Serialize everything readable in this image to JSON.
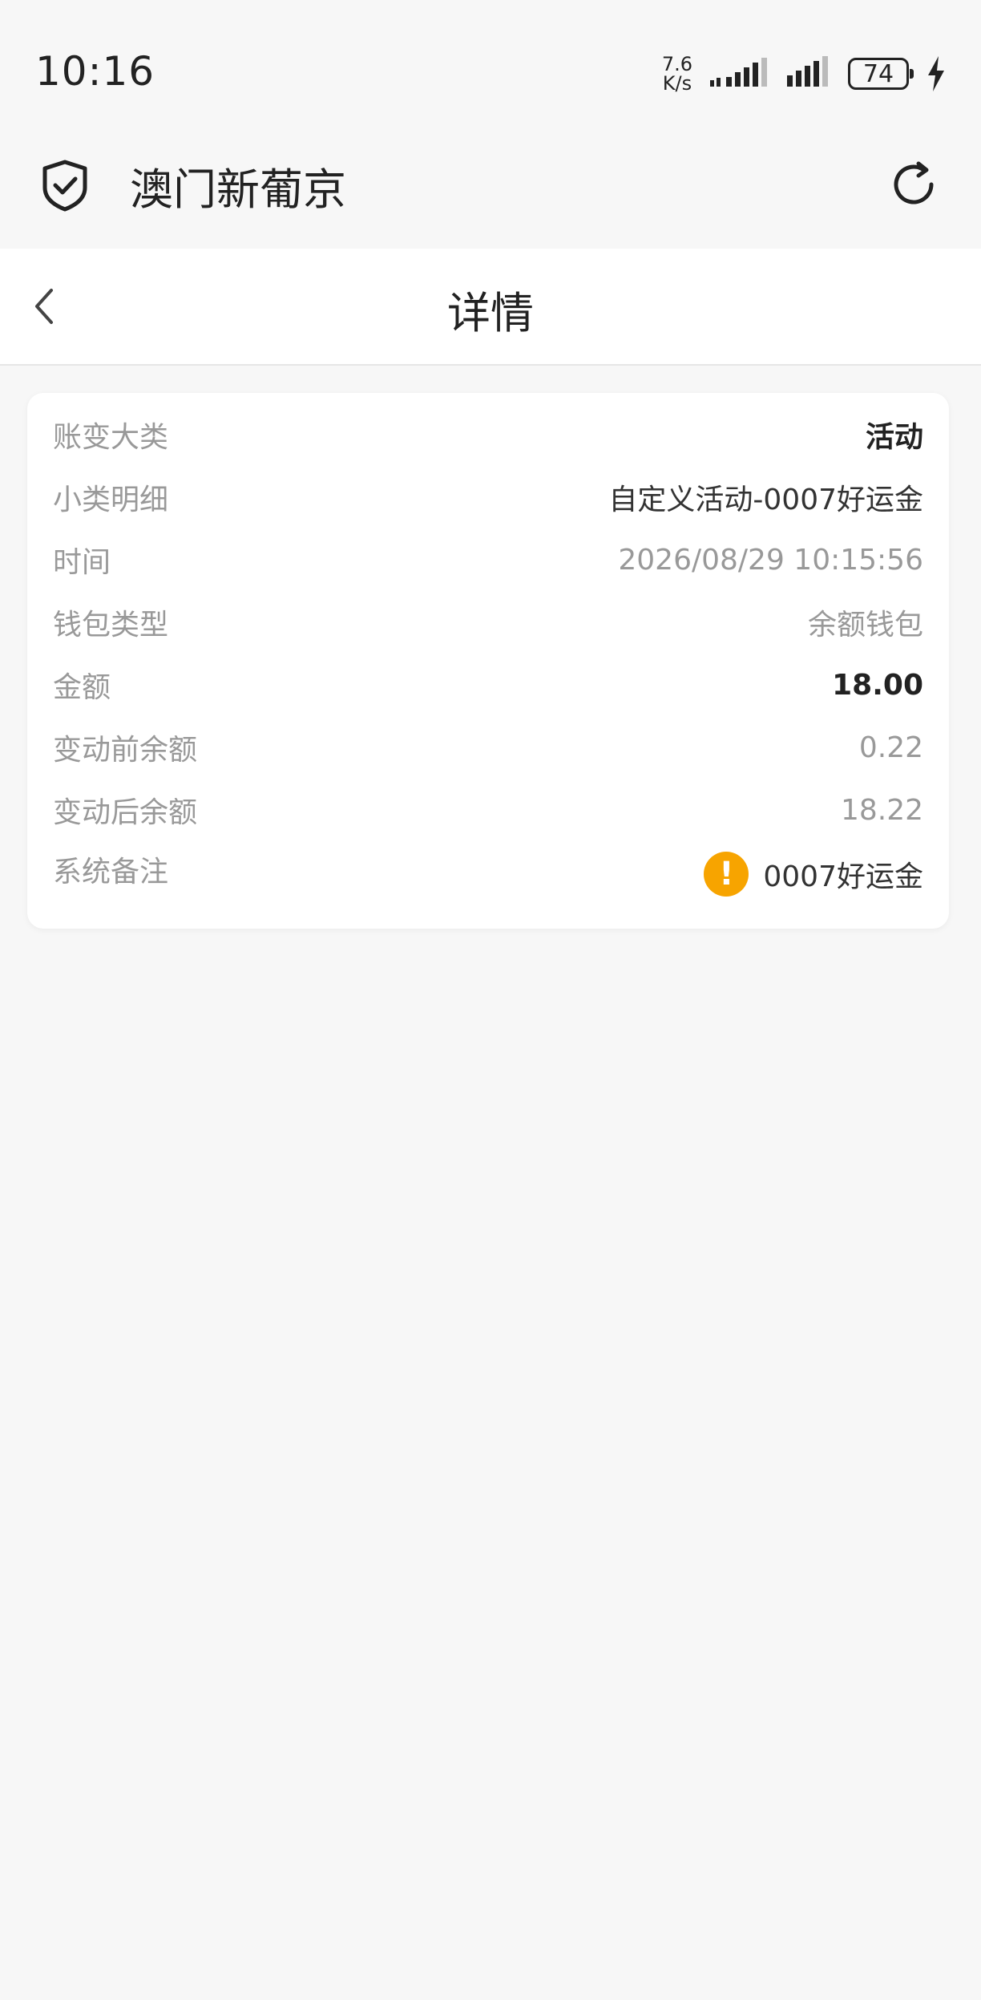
{
  "status_bar": {
    "time": "10:16",
    "net_speed_value": "7.6",
    "net_speed_unit": "K/s",
    "battery": "74"
  },
  "app_header": {
    "title": "澳门新葡京"
  },
  "nav": {
    "title": "详情"
  },
  "details": {
    "category_label": "账变大类",
    "category_value": "活动",
    "subcategory_label": "小类明细",
    "subcategory_value": "自定义活动-0007好运金",
    "time_label": "时间",
    "time_value": "2026/08/29 10:15:56",
    "wallet_label": "钱包类型",
    "wallet_value": "余额钱包",
    "amount_label": "金额",
    "amount_value": "18.00",
    "before_label": "变动前余额",
    "before_value": "0.22",
    "after_label": "变动后余额",
    "after_value": "18.22",
    "note_label": "系统备注",
    "note_value": "0007好运金"
  },
  "colors": {
    "accent_warning": "#f7a400",
    "background": "#f7f7f7"
  },
  "icons": {
    "app": "shield-check-icon",
    "refresh": "refresh-icon",
    "back": "chevron-left-icon",
    "warning": "warning-icon"
  }
}
